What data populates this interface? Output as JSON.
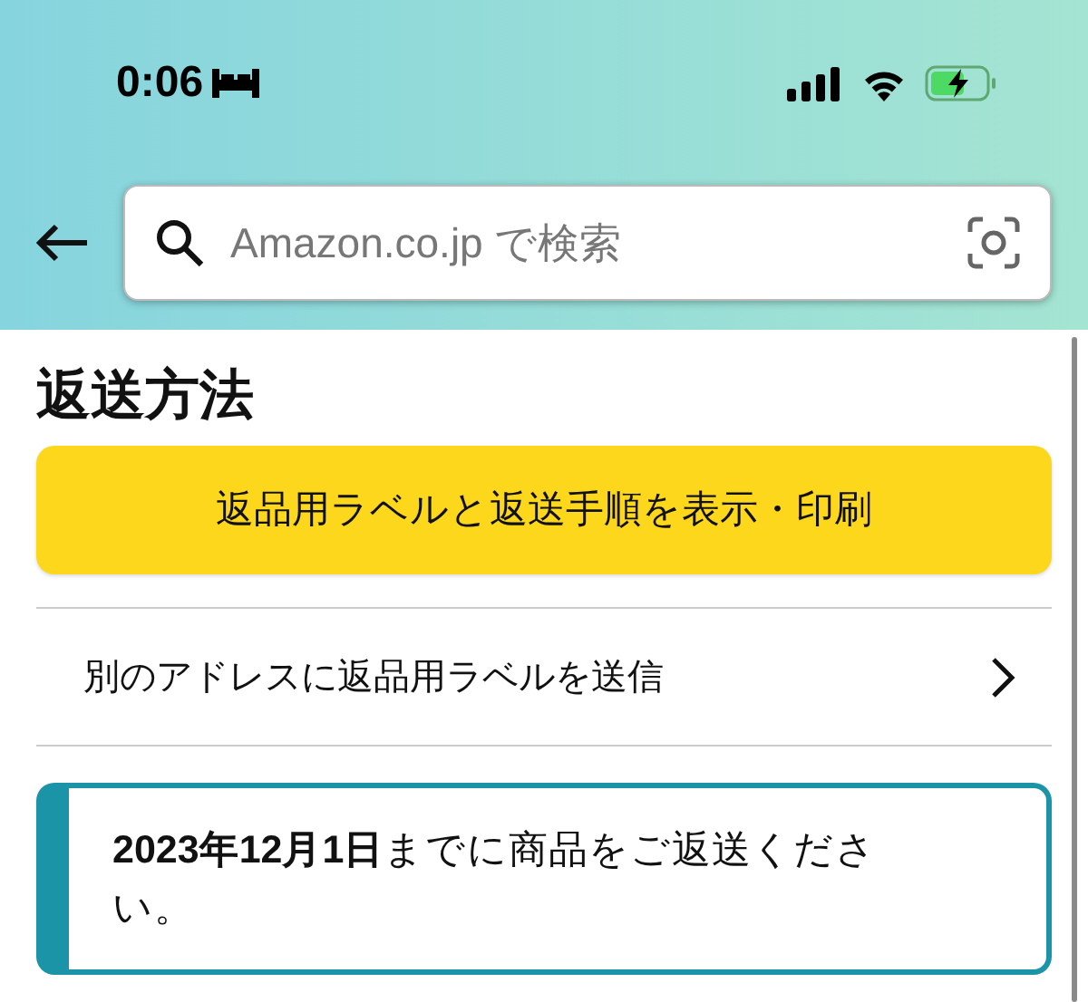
{
  "status_bar": {
    "time": "0:06"
  },
  "search": {
    "placeholder": "Amazon.co.jp で検索"
  },
  "title": "返送方法",
  "primary_button": "返品用ラベルと返送手順を表示・印刷",
  "menu_row": {
    "label": "別のアドレスに返品用ラベルを送信"
  },
  "notice": "**2023年12月1日**までに商品をご返送ください。"
}
